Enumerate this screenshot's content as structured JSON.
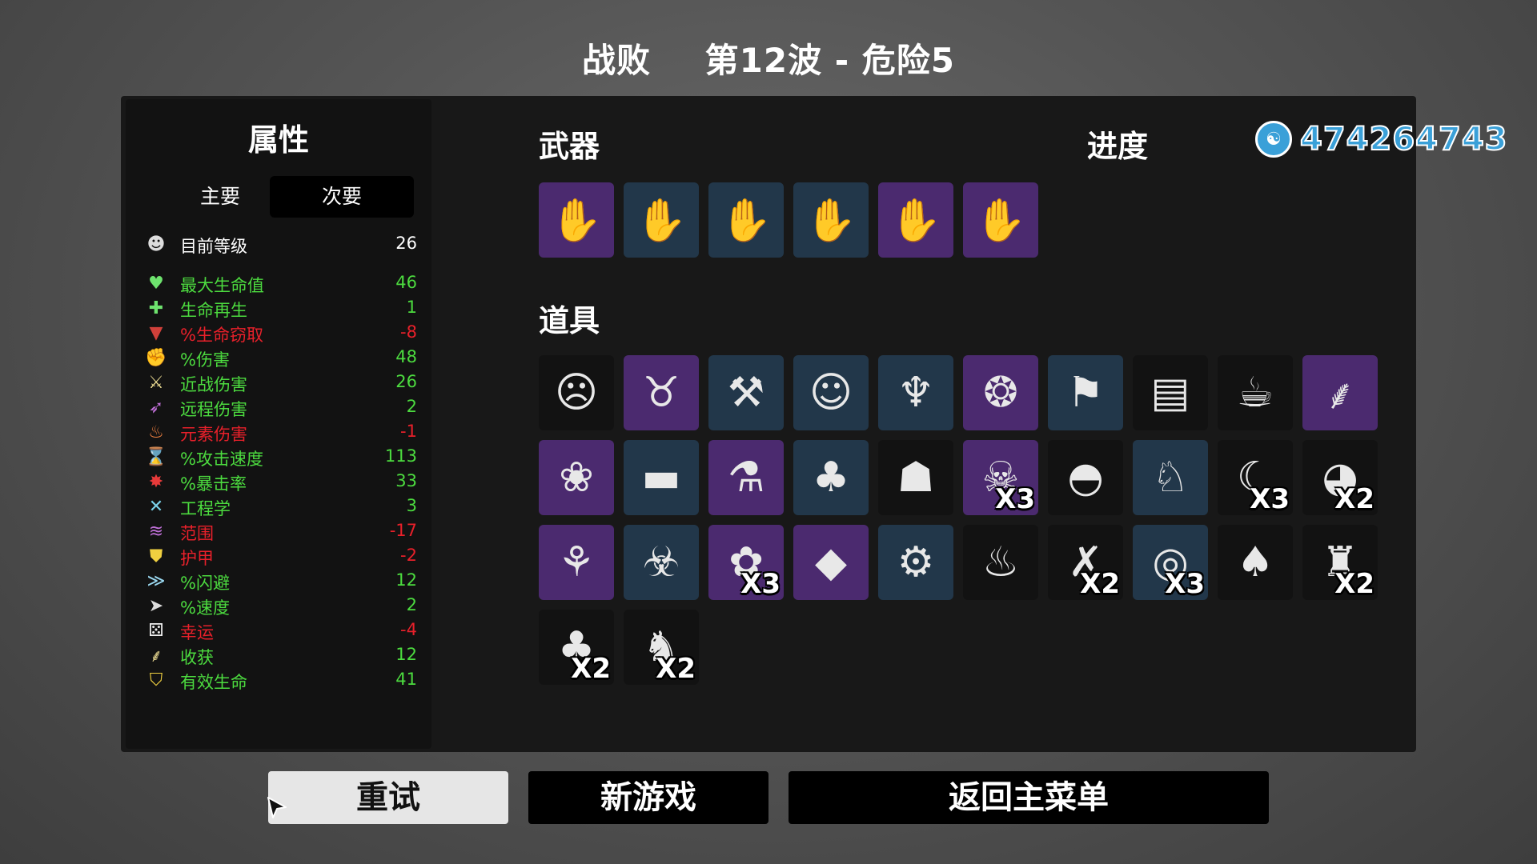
{
  "header": {
    "status": "战败",
    "wave": "第12波 - 危险5"
  },
  "stats_panel": {
    "title": "属性",
    "tabs": [
      {
        "label": "主要"
      },
      {
        "label": "次要",
        "selected": true
      }
    ],
    "rows": [
      {
        "icon": "level-icon",
        "glyph": "☻",
        "label": "目前等级",
        "value": "26",
        "color": "#ffffff",
        "glyph_color": "#dddddd"
      },
      {
        "icon": "heart-icon",
        "glyph": "♥",
        "label": "最大生命值",
        "value": "46",
        "color": "#4cdb3f",
        "glyph_color": "#6ee36e"
      },
      {
        "icon": "regen-icon",
        "glyph": "✚",
        "label": "生命再生",
        "value": "1",
        "color": "#4cdb3f",
        "glyph_color": "#6ee36e"
      },
      {
        "icon": "lifesteal-icon",
        "glyph": "▼",
        "label": "%生命窃取",
        "value": "-8",
        "color": "#e8202a",
        "glyph_color": "#d0403a"
      },
      {
        "icon": "damage-icon",
        "glyph": "✊",
        "label": "%伤害",
        "value": "48",
        "color": "#4cdb3f",
        "glyph_color": "#e06a6a"
      },
      {
        "icon": "melee-icon",
        "glyph": "⚔",
        "label": "近战伤害",
        "value": "26",
        "color": "#4cdb3f",
        "glyph_color": "#e8d890"
      },
      {
        "icon": "ranged-icon",
        "glyph": "➶",
        "label": "远程伤害",
        "value": "2",
        "color": "#4cdb3f",
        "glyph_color": "#c070d8"
      },
      {
        "icon": "elemental-icon",
        "glyph": "♨",
        "label": "元素伤害",
        "value": "-1",
        "color": "#e8202a",
        "glyph_color": "#f08040"
      },
      {
        "icon": "hourglass-icon",
        "glyph": "⌛",
        "label": "%攻击速度",
        "value": "113",
        "color": "#4cdb3f",
        "glyph_color": "#dddddd"
      },
      {
        "icon": "crit-icon",
        "glyph": "✸",
        "label": "%暴击率",
        "value": "33",
        "color": "#4cdb3f",
        "glyph_color": "#e83a3a"
      },
      {
        "icon": "wrench-icon",
        "glyph": "✕",
        "label": "工程学",
        "value": "3",
        "color": "#4cdb3f",
        "glyph_color": "#7ad0e8"
      },
      {
        "icon": "range-icon",
        "glyph": "≋",
        "label": "范围",
        "value": "-17",
        "color": "#e8202a",
        "glyph_color": "#c070d8"
      },
      {
        "icon": "armor-icon",
        "glyph": "⛊",
        "label": "护甲",
        "value": "-2",
        "color": "#e8202a",
        "glyph_color": "#f0d040"
      },
      {
        "icon": "dodge-icon",
        "glyph": "≫",
        "label": "%闪避",
        "value": "12",
        "color": "#4cdb3f",
        "glyph_color": "#9ad8f0"
      },
      {
        "icon": "speed-icon",
        "glyph": "➤",
        "label": "%速度",
        "value": "2",
        "color": "#4cdb3f",
        "glyph_color": "#dddddd"
      },
      {
        "icon": "dice-icon",
        "glyph": "⚄",
        "label": "幸运",
        "value": "-4",
        "color": "#e8202a",
        "glyph_color": "#eeeeee"
      },
      {
        "icon": "harvest-icon",
        "glyph": "⸙",
        "label": "收获",
        "value": "12",
        "color": "#4cdb3f",
        "glyph_color": "#e8d890"
      },
      {
        "icon": "shield-heart-icon",
        "glyph": "⛉",
        "label": "有效生命",
        "value": "41",
        "color": "#4cdb3f",
        "glyph_color": "#f0d040"
      }
    ]
  },
  "weapons": {
    "title": "武器",
    "items": [
      {
        "icon": "claw-glove-icon",
        "glyph": "✋",
        "tier": "purple"
      },
      {
        "icon": "claw-glove-icon",
        "glyph": "✋",
        "tier": "blue"
      },
      {
        "icon": "claw-glove-icon",
        "glyph": "✋",
        "tier": "blue"
      },
      {
        "icon": "claw-glove-icon",
        "glyph": "✋",
        "tier": "blue"
      },
      {
        "icon": "claw-glove-icon",
        "glyph": "✋",
        "tier": "purple"
      },
      {
        "icon": "claw-glove-icon",
        "glyph": "✋",
        "tier": "purple"
      }
    ]
  },
  "progress": {
    "title": "进度"
  },
  "materials": {
    "icon": "material-icon",
    "value": "474264743"
  },
  "items": {
    "title": "道具",
    "list": [
      {
        "icon": "ghost-mask-icon",
        "glyph": "☹",
        "tier": "black",
        "qty": ""
      },
      {
        "icon": "horned-skull-icon",
        "glyph": "♉",
        "tier": "purple",
        "qty": ""
      },
      {
        "icon": "tool-icon",
        "glyph": "⚒",
        "tier": "blue",
        "qty": ""
      },
      {
        "icon": "ninja-icon",
        "glyph": "☺",
        "tier": "blue",
        "qty": ""
      },
      {
        "icon": "claws-icon",
        "glyph": "♆",
        "tier": "blue",
        "qty": ""
      },
      {
        "icon": "tardigrade-icon",
        "glyph": "❂",
        "tier": "purple",
        "qty": ""
      },
      {
        "icon": "cape-icon",
        "glyph": "⚑",
        "tier": "blue",
        "qty": ""
      },
      {
        "icon": "banknote-icon",
        "glyph": "▤",
        "tier": "black",
        "qty": ""
      },
      {
        "icon": "coffee-icon",
        "glyph": "☕",
        "tier": "black",
        "qty": ""
      },
      {
        "icon": "wheat-icon",
        "glyph": "⸙",
        "tier": "purple",
        "qty": ""
      },
      {
        "icon": "mushrooms-icon",
        "glyph": "❀",
        "tier": "purple",
        "qty": ""
      },
      {
        "icon": "cloth-icon",
        "glyph": "▬",
        "tier": "blue",
        "qty": ""
      },
      {
        "icon": "bottle-icon",
        "glyph": "⚗",
        "tier": "purple",
        "qty": ""
      },
      {
        "icon": "garden-icon",
        "glyph": "♣",
        "tier": "blue",
        "qty": ""
      },
      {
        "icon": "juice-icon",
        "glyph": "☗",
        "tier": "black",
        "qty": ""
      },
      {
        "icon": "zombie-icon",
        "glyph": "☠",
        "tier": "purple",
        "qty": "X3"
      },
      {
        "icon": "beanie-icon",
        "glyph": "◓",
        "tier": "black",
        "qty": ""
      },
      {
        "icon": "rabbit-icon",
        "glyph": "♘",
        "tier": "blue",
        "qty": ""
      },
      {
        "icon": "scythe-icon",
        "glyph": "☾",
        "tier": "black",
        "qty": "X3"
      },
      {
        "icon": "duck-icon",
        "glyph": "◕",
        "tier": "black",
        "qty": "X2"
      },
      {
        "icon": "mortar-icon",
        "glyph": "⚘",
        "tier": "purple",
        "qty": ""
      },
      {
        "icon": "raccoon-icon",
        "glyph": "☣",
        "tier": "blue",
        "qty": ""
      },
      {
        "icon": "plant-monster-icon",
        "glyph": "✿",
        "tier": "purple",
        "qty": "X3"
      },
      {
        "icon": "whetstone-icon",
        "glyph": "◆",
        "tier": "purple",
        "qty": ""
      },
      {
        "icon": "turret-icon",
        "glyph": "⚙",
        "tier": "blue",
        "qty": ""
      },
      {
        "icon": "meat-icon",
        "glyph": "♨",
        "tier": "black",
        "qty": ""
      },
      {
        "icon": "red-scarf-icon",
        "glyph": "✗",
        "tier": "black",
        "qty": "X2"
      },
      {
        "icon": "belt-icon",
        "glyph": "◎",
        "tier": "blue",
        "qty": "X3"
      },
      {
        "icon": "palm-tree-icon",
        "glyph": "♠",
        "tier": "black",
        "qty": ""
      },
      {
        "icon": "sack-icon",
        "glyph": "♜",
        "tier": "black",
        "qty": "X2"
      },
      {
        "icon": "tree-icon",
        "glyph": "♣",
        "tier": "black",
        "qty": "X2"
      },
      {
        "icon": "dog-icon",
        "glyph": "♞",
        "tier": "black",
        "qty": "X2"
      }
    ]
  },
  "buttons": {
    "retry": "重试",
    "new_game": "新游戏",
    "main_menu": "返回主菜单"
  },
  "colors": {
    "purple_tier": "#4b2a6f",
    "blue_tier": "#22374a",
    "positive": "#4cdb3f",
    "negative": "#e8202a",
    "materials": "#3aa0d8"
  }
}
